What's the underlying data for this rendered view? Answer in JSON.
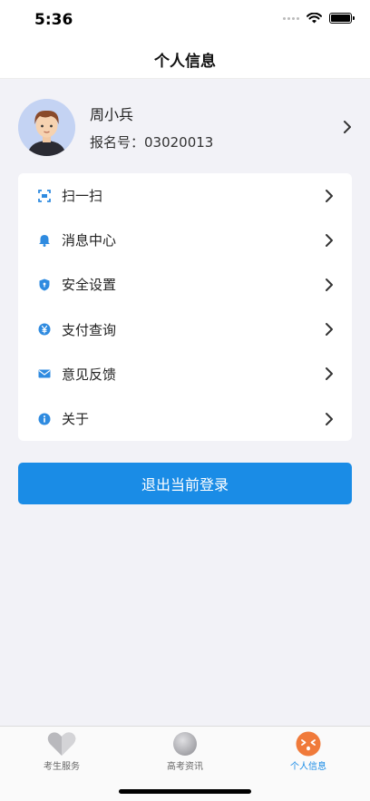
{
  "status_bar": {
    "time": "5:36"
  },
  "nav": {
    "title": "个人信息"
  },
  "profile": {
    "name": "周小兵",
    "registration": "报名号：03020013"
  },
  "menu": {
    "items": [
      {
        "label": "扫一扫",
        "icon": "scan-icon"
      },
      {
        "label": "消息中心",
        "icon": "bell-icon"
      },
      {
        "label": "安全设置",
        "icon": "shield-icon"
      },
      {
        "label": "支付查询",
        "icon": "yen-icon"
      },
      {
        "label": "意见反馈",
        "icon": "mail-icon"
      },
      {
        "label": "关于",
        "icon": "info-icon"
      }
    ]
  },
  "logout": {
    "label": "退出当前登录"
  },
  "tabs": [
    {
      "label": "考生服务",
      "icon": "heart-icon",
      "active": false
    },
    {
      "label": "高考资讯",
      "icon": "ball-icon",
      "active": false
    },
    {
      "label": "个人信息",
      "icon": "face-icon",
      "active": true
    }
  ],
  "colors": {
    "accent": "#1a8ce6",
    "background": "#f2f2f7",
    "tab_active": "#f07a3a"
  }
}
